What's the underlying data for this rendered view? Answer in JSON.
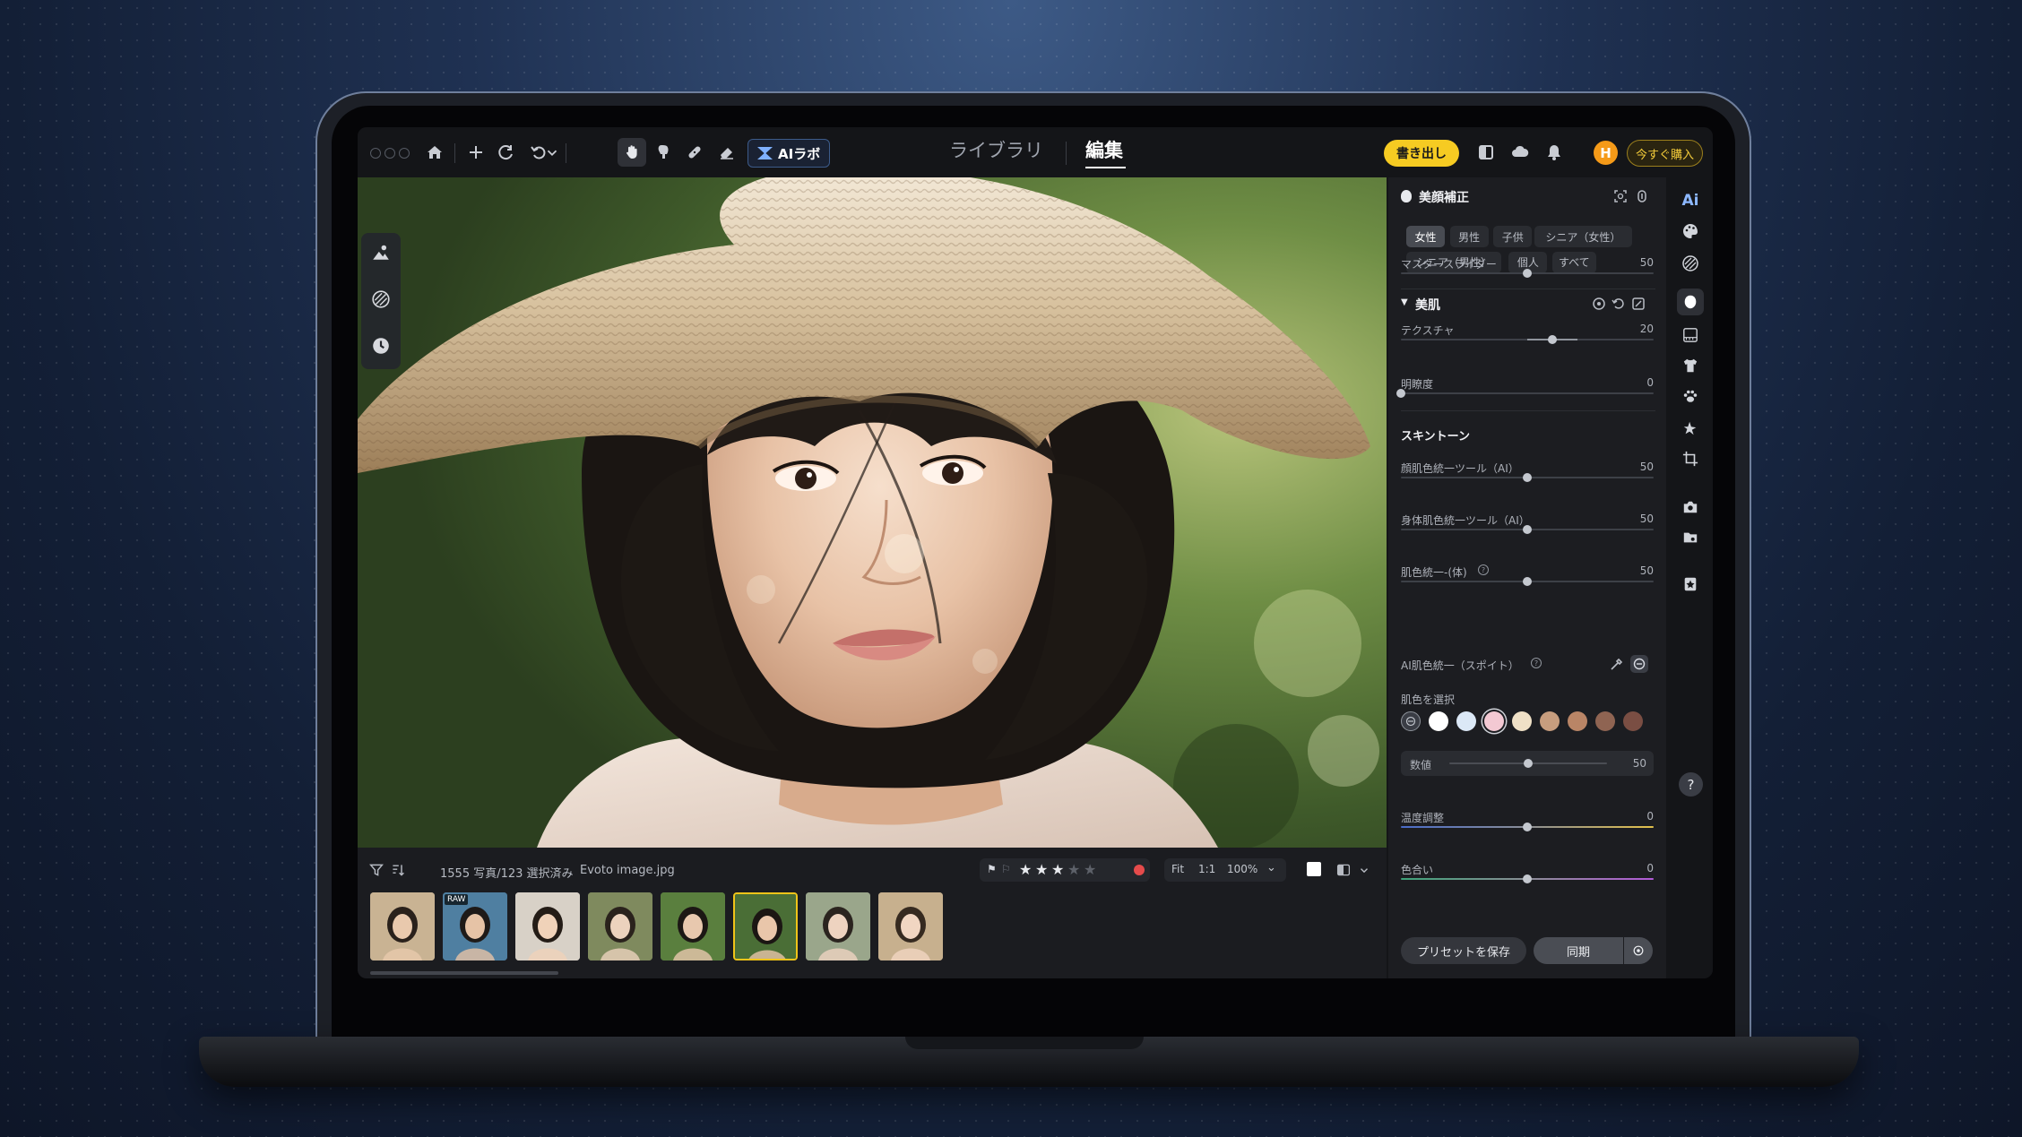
{
  "topbar": {
    "ai_lab_label": "AIラボ",
    "nav_library": "ライブラリ",
    "nav_edit": "編集",
    "export_label": "書き出し",
    "avatar_initial": "H",
    "buy_label": "今すぐ購入"
  },
  "filmstrip": {
    "photo_count": "1555 写真/123 選択済み",
    "file_name": "Evoto image.jpg",
    "rating": 3,
    "zoom_fit": "Fit",
    "zoom_one": "1:1",
    "zoom_percent": "100%",
    "raw_badge": "RAW",
    "thumbs": [
      {
        "bg": "#c9b393",
        "face": "#e9c9ad",
        "hair": "#2a211b"
      },
      {
        "bg": "#4f7fa1",
        "face": "#e6c3a6",
        "hair": "#1e1a18"
      },
      {
        "bg": "#d8d1c7",
        "face": "#f0d2b9",
        "hair": "#241c16"
      },
      {
        "bg": "#7f8a5e",
        "face": "#ecd2bd",
        "hair": "#2a221c"
      },
      {
        "bg": "#5a7f3e",
        "face": "#e8c8ae",
        "hair": "#1c1714"
      },
      {
        "bg": "#4a6e36",
        "face": "#e9c6aa",
        "hair": "#1b1613",
        "selected": true
      },
      {
        "bg": "#9aa68b",
        "face": "#eed3c0",
        "hair": "#2b241f"
      },
      {
        "bg": "#c7b08e",
        "face": "#f1d6c2",
        "hair": "#362a20"
      }
    ]
  },
  "panel": {
    "beauty_title": "美顔補正",
    "chips": [
      "女性",
      "男性",
      "子供",
      "シニア（女性）",
      "シニア（男性）",
      "個人",
      "すべて"
    ],
    "master_slider_label": "マスタースライダー",
    "master_slider_value": 50,
    "skin_section": "美肌",
    "texture_label": "テクスチャ",
    "texture_value": 20,
    "clarity_label": "明瞭度",
    "clarity_value": 0,
    "skin_tone_section": "スキントーン",
    "face_tone_label": "顔肌色統一ツール（AI）",
    "face_tone_value": 50,
    "body_tone_label": "身体肌色統一ツール（AI）",
    "body_tone_value": 50,
    "body_unify_label": "肌色統一-(体)",
    "body_unify_value": 50,
    "ai_unify_label": "AI肌色統一（スポイト）",
    "choose_skin_label": "肌色を選択",
    "swatches": [
      "#ffffff",
      "#dbe8f6",
      "#f3c9d3",
      "#efe0c6",
      "#c79d7e",
      "#b98566",
      "#8f6452",
      "#7a4e43"
    ],
    "numeric_label": "数値",
    "numeric_value": 50,
    "temperature_label": "温度調整",
    "temperature_value": 0,
    "tint_label": "色合い",
    "tint_value": 0,
    "save_preset_label": "プリセットを保存",
    "sync_label": "同期"
  },
  "rail": {
    "ai_label": "Ai",
    "help_label": "?"
  },
  "colors": {
    "accent_yellow": "#f6cb22",
    "avatar_orange": "#f59a18",
    "panel_bg": "#1c1d21"
  }
}
